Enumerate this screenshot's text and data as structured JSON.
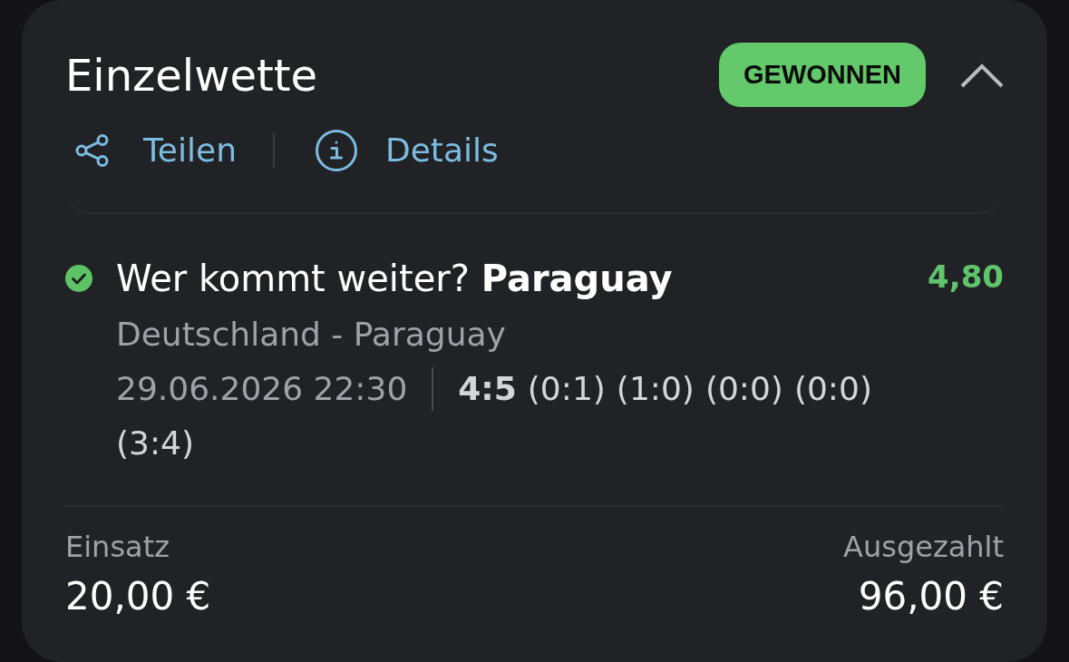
{
  "bet": {
    "title": "Einzelwette",
    "status": {
      "label": "GEWONNEN",
      "kind": "won"
    },
    "expanded": true
  },
  "actions": [
    {
      "kind": "share",
      "label": "Teilen"
    },
    {
      "kind": "info",
      "label": "Details"
    }
  ],
  "selections": [
    {
      "won": true,
      "market": "Wer kommt weiter? **Paraguay**",
      "odds": "4,80",
      "match": "Deutschland - Paraguay",
      "date": "29.06.2026 22:30",
      "result": "4:5",
      "periods": [
        "(0:1)",
        "(1:0)",
        "(0:0)",
        "(0:0)",
        "(3:4)"
      ]
    }
  ],
  "summary": [
    {
      "label": "Einsatz",
      "value": "20,00 €"
    },
    {
      "label": "Ausgezahlt",
      "value": "96,00 €"
    }
  ]
}
